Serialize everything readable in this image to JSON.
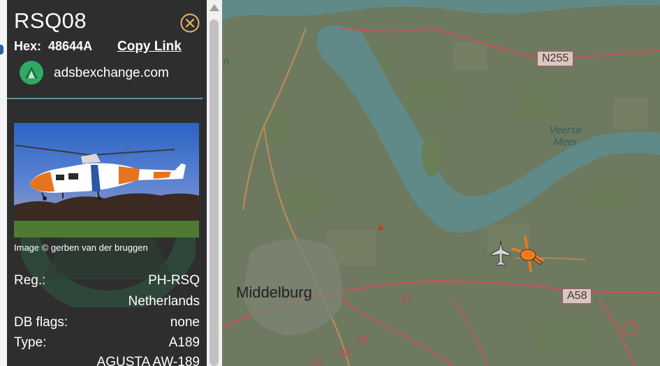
{
  "aircraft": {
    "callsign": "RSQ08",
    "hex_label": "Hex:",
    "hex_value": "48644A",
    "copy_link": "Copy Link"
  },
  "source": {
    "site": "adsbexchange.com"
  },
  "photo": {
    "credit": "Image © gerben van der bruggen"
  },
  "details": {
    "reg_label": "Reg.:",
    "reg_value": "PH-RSQ",
    "country": "Netherlands",
    "db_flags_label": "DB flags:",
    "db_flags_value": "none",
    "type_label": "Type:",
    "type_value": "A189",
    "model": "AGUSTA AW-189"
  },
  "map": {
    "city": "Middelburg",
    "lake": "Veerse Meer",
    "lake_line1": "Veerse",
    "lake_line2": "Meer",
    "road_badges": {
      "n255": "N255",
      "a58": "A58"
    },
    "road_numbers": {
      "r37": "37",
      "r38a": "38",
      "r38b": "38",
      "r39": "39"
    },
    "partial_label": "n"
  },
  "colors": {
    "panel_bg": "#2e2e2e",
    "accent_green": "#2faa63",
    "divider": "#5d8fa8",
    "aircraft_orange": "#f07a1a",
    "water": "#5f8a87",
    "land": "#6e7a60"
  },
  "icons": {
    "close": "close-circle-icon",
    "site_logo": "adsbexchange-logo-icon",
    "aircraft": "helicopter-icon",
    "other_aircraft": "plane-icon"
  }
}
